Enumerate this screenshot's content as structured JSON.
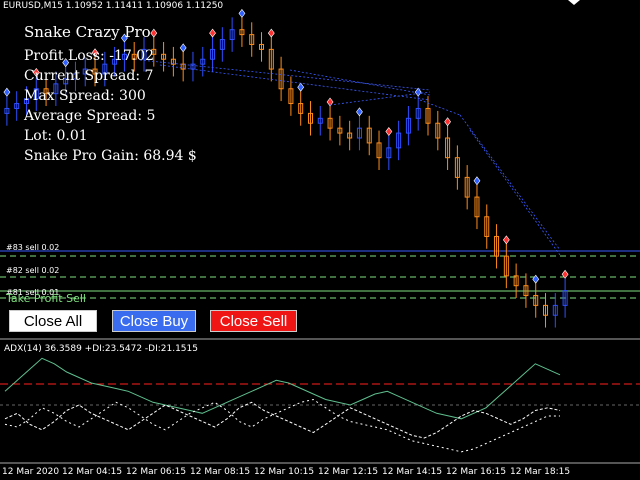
{
  "window": {
    "symbol_header": "EURUSD,M15  1.10952 1.11411 1.10906 1.11250"
  },
  "info_panel": {
    "title": "Snake Crazy Pro",
    "profit_loss": "Profit Loss: -17.02",
    "current_spread": "Current Spread: 7",
    "max_spread": "Max Spread: 300",
    "average_spread": "Average Spread: 5",
    "lot": "Lot: 0.01",
    "gain": "Snake Pro Gain: 68.94 $"
  },
  "orders": [
    {
      "label": "#83 sell 0.02"
    },
    {
      "label": "#82 sell 0.02"
    },
    {
      "label": "#81 sell 0.01"
    }
  ],
  "take_profit_label": "Take Profit Sell",
  "buttons": {
    "close_all": "Close All",
    "close_buy": "Close Buy",
    "close_sell": "Close Sell"
  },
  "indicator": {
    "label": "ADX(14) 36.3589 +DI:23.5472 -DI:21.1515"
  },
  "time_axis": [
    "12 Mar 2020",
    "12 Mar 04:15",
    "12 Mar 06:15",
    "12 Mar 08:15",
    "12 Mar 10:15",
    "12 Mar 12:15",
    "12 Mar 14:15",
    "12 Mar 16:15",
    "12 Mar 18:15"
  ],
  "colors": {
    "background": "#000000",
    "bull_candle": "#2f4fff",
    "bear_candle": "#ff8c1a",
    "order_line": "#3a5cff",
    "tp_line": "#7fe07f",
    "adx_line": "#5fbf8f",
    "level_line": "#ff2020",
    "close_all_bg": "#ffffff",
    "close_buy_bg": "#3a6cf0",
    "close_sell_bg": "#f01515"
  },
  "chart_data": {
    "type": "candlestick",
    "series": [
      {
        "name": "EURUSD,M15",
        "values": [
          100,
          101,
          102,
          104,
          103,
          105,
          106,
          107,
          108,
          107,
          109,
          110,
          111,
          110,
          112,
          111,
          110,
          109,
          108,
          109,
          110,
          112,
          114,
          116,
          115,
          113,
          112,
          108,
          104,
          101,
          99,
          97,
          98,
          96,
          95,
          94,
          96,
          93,
          90,
          92,
          95,
          98,
          100,
          97,
          94,
          90,
          86,
          82,
          78,
          74,
          70,
          66,
          64,
          62,
          60,
          58,
          60,
          63
        ]
      },
      {
        "name": "ADX(14)",
        "values": [
          30,
          34,
          38,
          42,
          40,
          37,
          35,
          33,
          32,
          31,
          30,
          28,
          26,
          25,
          24,
          23,
          22,
          24,
          26,
          28,
          30,
          32,
          34,
          33,
          31,
          29,
          27,
          26,
          25,
          27,
          29,
          30,
          28,
          26,
          24,
          22,
          21,
          20,
          22,
          24,
          28,
          32,
          36,
          40,
          38,
          36
        ]
      },
      {
        "name": "+DI",
        "values": [
          20,
          22,
          18,
          16,
          19,
          23,
          25,
          22,
          20,
          18,
          16,
          19,
          22,
          25,
          23,
          21,
          19,
          17,
          20,
          24,
          26,
          23,
          21,
          19,
          17,
          15,
          18,
          21,
          24,
          22,
          20,
          18,
          16,
          14,
          13,
          15,
          18,
          21,
          23,
          22,
          20,
          18,
          20,
          23,
          24,
          23
        ]
      },
      {
        "name": "-DI",
        "values": [
          18,
          17,
          20,
          24,
          22,
          19,
          17,
          20,
          23,
          26,
          24,
          21,
          18,
          16,
          19,
          22,
          24,
          26,
          23,
          19,
          17,
          20,
          22,
          24,
          26,
          27,
          24,
          21,
          19,
          18,
          17,
          16,
          14,
          12,
          11,
          10,
          9,
          8,
          9,
          11,
          13,
          15,
          17,
          19,
          21,
          21
        ]
      }
    ]
  }
}
